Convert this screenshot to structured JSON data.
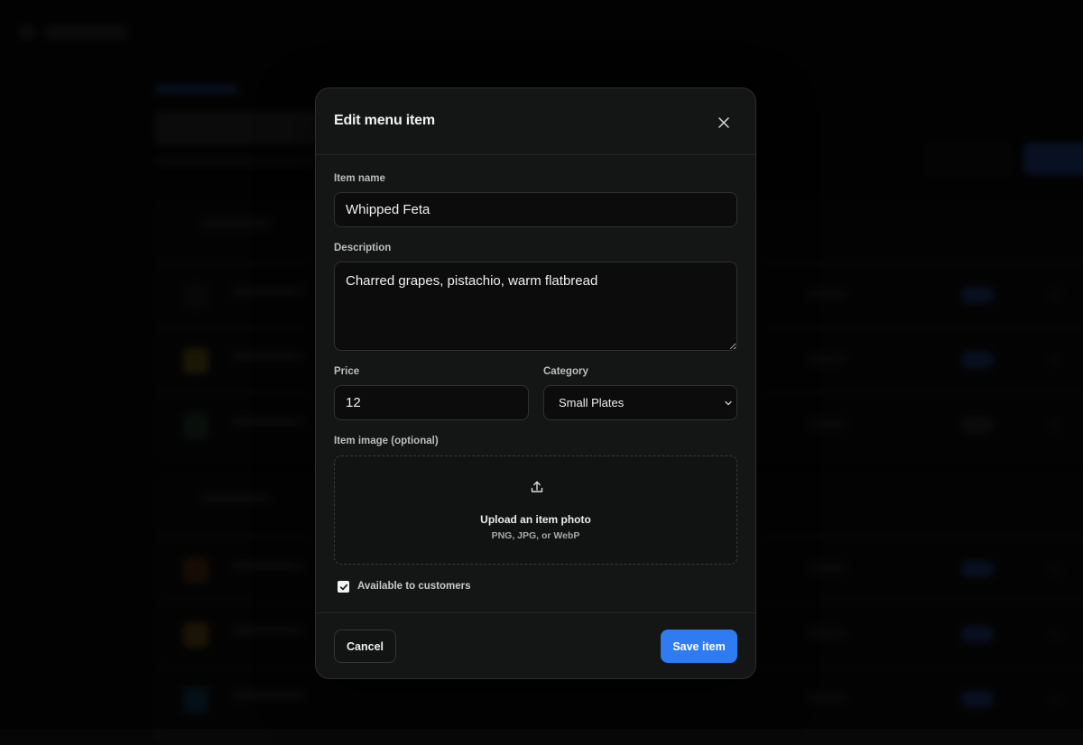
{
  "modal": {
    "title": "Edit menu item"
  },
  "form": {
    "item_name": {
      "label": "Item name",
      "value": "Whipped Feta"
    },
    "description": {
      "label": "Description",
      "value": "Charred grapes, pistachio, warm flatbread"
    },
    "price": {
      "label": "Price",
      "value": "12"
    },
    "category": {
      "label": "Category",
      "selected": "Small Plates"
    },
    "image": {
      "label": "Item image (optional)",
      "upload_title": "Upload an item photo",
      "upload_hint": "PNG, JPG, or WebP"
    },
    "available": {
      "label": "Available to customers",
      "checked": true
    }
  },
  "footer": {
    "cancel_label": "Cancel",
    "save_label": "Save item"
  },
  "colors": {
    "accent": "#2f7bf2",
    "modal_bg": "#141515",
    "page_bg": "#060606"
  }
}
